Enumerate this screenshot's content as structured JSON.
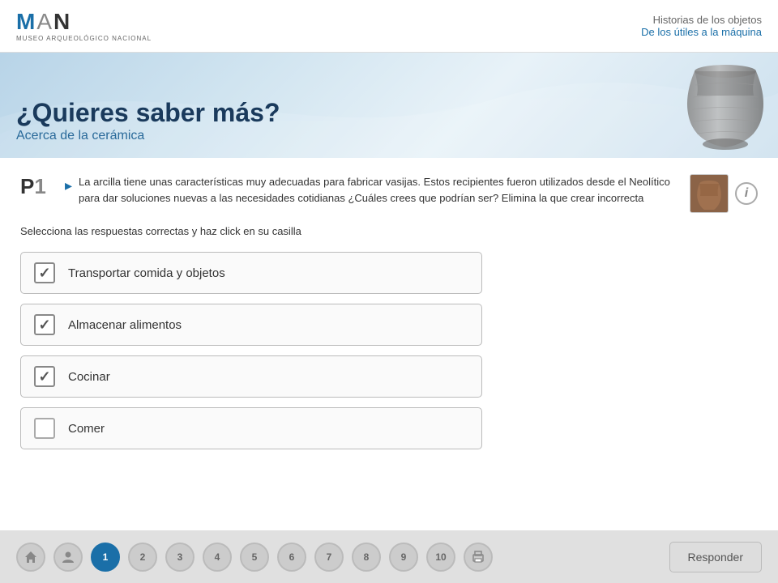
{
  "header": {
    "logo_man": "MAN",
    "logo_subtitle": "MUSEO ARQUEOLÓGICO NACIONAL",
    "title_main": "Historias de los objetos",
    "title_sub": "De los útiles a la máquina"
  },
  "banner": {
    "heading": "¿Quieres saber más?",
    "subheading": "Acerca de la cerámica"
  },
  "question": {
    "number": "P1",
    "bullet": "▸",
    "text": "La arcilla tiene unas características muy adecuadas para fabricar vasijas. Estos recipientes fueron utilizados desde el Neolítico para dar soluciones nuevas a las necesidades cotidianas ¿Cuáles crees que podrían ser? Elimina la que crear incorrecta",
    "info_icon": "i"
  },
  "instruction": "Selecciona las respuestas correctas y haz click en su casilla",
  "options": [
    {
      "id": "opt1",
      "label": "Transportar comida y objetos",
      "checked": true
    },
    {
      "id": "opt2",
      "label": "Almacenar alimentos",
      "checked": true
    },
    {
      "id": "opt3",
      "label": "Cocinar",
      "checked": true
    },
    {
      "id": "opt4",
      "label": "Comer",
      "checked": false
    }
  ],
  "footer": {
    "nav_items": [
      "home",
      "person",
      "1",
      "2",
      "3",
      "4",
      "5",
      "6",
      "7",
      "8",
      "9",
      "10",
      "print"
    ],
    "respond_label": "Responder"
  }
}
